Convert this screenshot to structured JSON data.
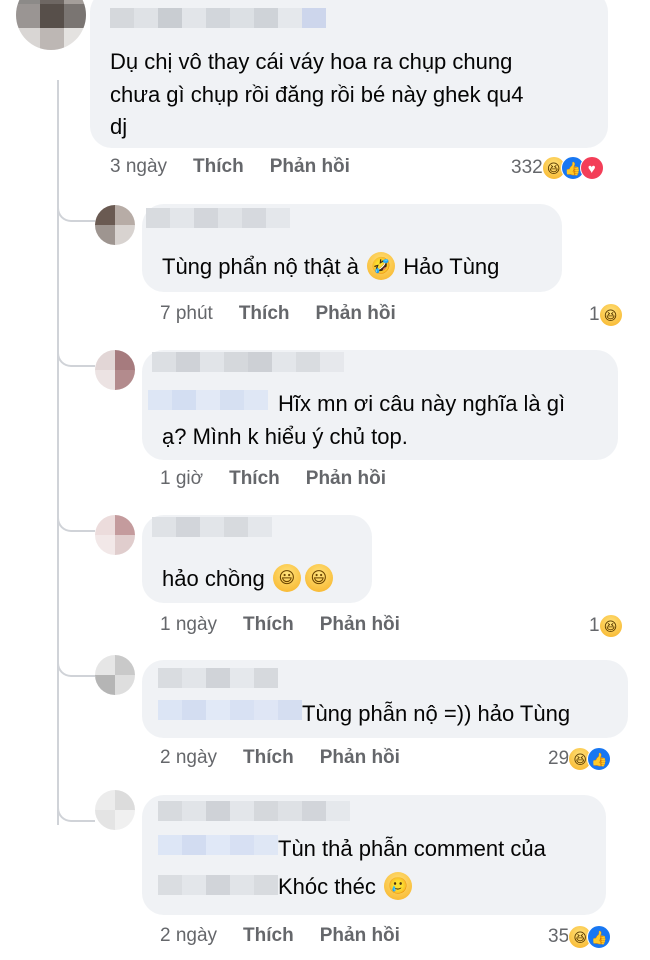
{
  "colors": {
    "bubble": "#f0f2f5",
    "meta_text": "#65676b",
    "thread_line": "#d0d3d8",
    "like_blue": "#1877f2",
    "love_red": "#f33e58",
    "haha_yellow": "#f7b125"
  },
  "comments": [
    {
      "lines": [
        "Dụ chị vô thay cái váy hoa ra chụp chung",
        "chưa gì chụp rồi đăng rồi bé này ghek qu4",
        "dj"
      ],
      "time": "3 ngày",
      "like": "Thích",
      "reply": "Phản hồi",
      "reaction_count": "332",
      "reactions": [
        "haha-icon",
        "like-icon",
        "love-icon"
      ]
    },
    {
      "text_a": "Tùng phẩn nộ thật à",
      "emoji": "rolling-laughing-emoji",
      "text_b": "Hảo Tùng",
      "time": "7 phút",
      "like": "Thích",
      "reply": "Phản hồi",
      "reaction_count": "1",
      "reactions": [
        "haha-icon"
      ]
    },
    {
      "line1": "Hĩx mn ơi câu này nghĩa là gì",
      "line2": "ạ? Mình k hiểu ý chủ top.",
      "time": "1 giờ",
      "like": "Thích",
      "reply": "Phản hồi"
    },
    {
      "text": "hảo chồng",
      "emoji": "grinning-emoji",
      "time": "1 ngày",
      "like": "Thích",
      "reply": "Phản hồi",
      "reaction_count": "1",
      "reactions": [
        "haha-icon"
      ]
    },
    {
      "text": "Tùng phẫn nộ =)) hảo Tùng",
      "time": "2 ngày",
      "like": "Thích",
      "reply": "Phản hồi",
      "reaction_count": "29",
      "reactions": [
        "haha-icon",
        "like-icon"
      ]
    },
    {
      "line1": "Tùn thả phẫn comment của",
      "line2": "Khóc théc",
      "emoji": "crying-laughing-emoji",
      "time": "2 ngày",
      "like": "Thích",
      "reply": "Phản hồi",
      "reaction_count": "35",
      "reactions": [
        "haha-icon",
        "like-icon"
      ]
    }
  ]
}
